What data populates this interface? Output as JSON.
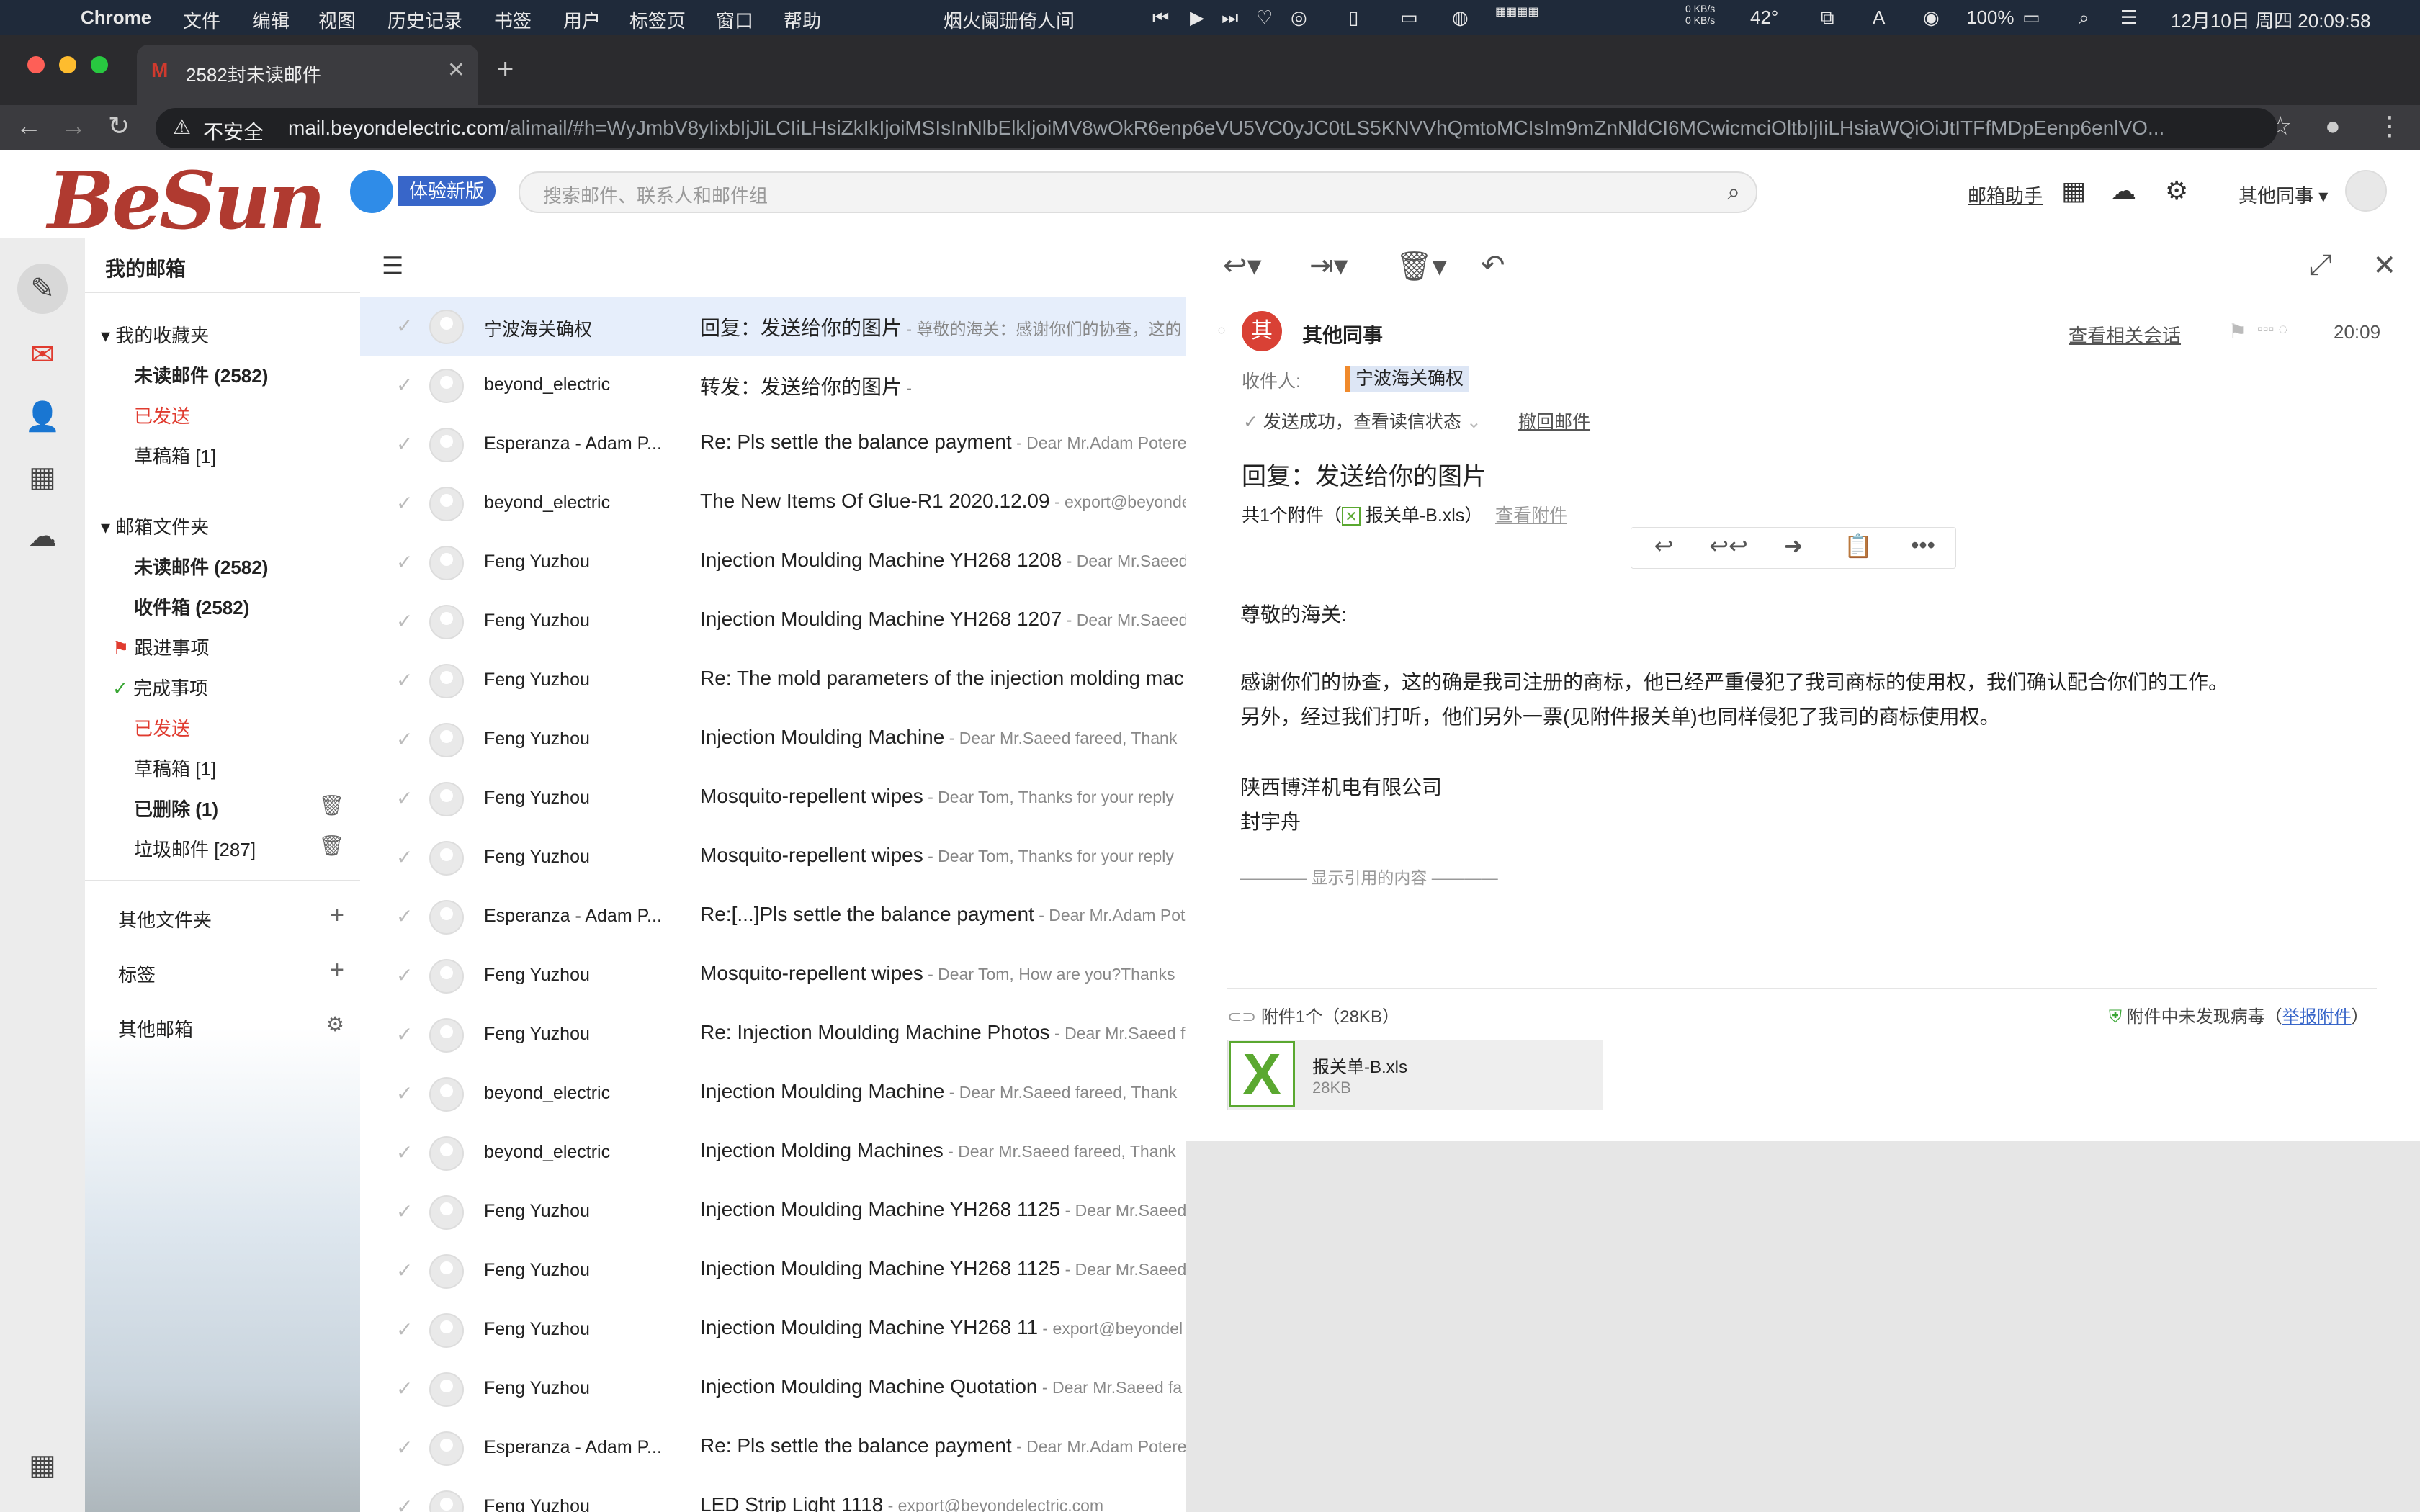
{
  "menubar": {
    "app": "Chrome",
    "items": [
      "文件",
      "编辑",
      "视图",
      "历史记录",
      "书签",
      "用户",
      "标签页",
      "窗口",
      "帮助"
    ],
    "now_playing": "烟火阑珊倚人间",
    "net_up": "0 KB/s",
    "net_down": "0 KB/s",
    "temp": "42°",
    "battery": "100%",
    "datetime": "12月10日 周四 20:09:58"
  },
  "browser": {
    "tab_title": "2582封未读邮件",
    "insecure_label": "不安全",
    "url_host": "mail.beyondelectric.com",
    "url_rest": "/alimail/#h=WyJmbV8yIixbIjJiLCIiLHsiZkIkIjoiMSIsInNlbElkIjoiMV8wOkR6enp6eVU5VC0yJC0tLS5KNVVhQmtoMCIsIm9mZnNldCI6MCwicmciOltbIjIiLHsiaWQiOiJtITFfMDpEenp6enlVO..."
  },
  "header": {
    "logo_text": "BeSun",
    "try_new": "体验新版",
    "search_placeholder": "搜索邮件、联系人和邮件组",
    "assistant": "邮箱助手",
    "account": "其他同事"
  },
  "folders": {
    "title": "我的邮箱",
    "fav_section": "我的收藏夹",
    "fav_unread": "未读邮件 (2582)",
    "fav_sent": "已发送",
    "fav_drafts": "草稿箱 [1]",
    "mail_section": "邮箱文件夹",
    "unread": "未读邮件 (2582)",
    "inbox": "收件箱 (2582)",
    "followup": "跟进事项",
    "done": "完成事项",
    "sent": "已发送",
    "drafts": "草稿箱 [1]",
    "deleted": "已删除 (1)",
    "spam": "垃圾邮件 [287]",
    "other_folders": "其他文件夹",
    "tags": "标签",
    "other_mailboxes": "其他邮箱"
  },
  "messages": [
    {
      "from": "宁波海关确权",
      "subject": "回复：发送给你的图片",
      "preview": " - 尊敬的海关：感谢你们的协查，这的",
      "selected": true
    },
    {
      "from": "beyond_electric",
      "subject": "转发：发送给你的图片",
      "preview": " -"
    },
    {
      "from": "Esperanza - Adam P...",
      "subject": "Re: Pls settle the balance payment",
      "preview": " - Dear Mr.Adam Potere"
    },
    {
      "from": "beyond_electric",
      "subject": "The New Items Of Glue-R1 2020.12.09",
      "preview": " - export@beyonde"
    },
    {
      "from": "Feng Yuzhou",
      "subject": "Injection Moulding Machine YH268 1208",
      "preview": " - Dear Mr.Saeed"
    },
    {
      "from": "Feng Yuzhou",
      "subject": "Injection Moulding Machine YH268 1207",
      "preview": " - Dear Mr.Saeed"
    },
    {
      "from": "Feng Yuzhou",
      "subject": "Re: The mold parameters of the injection molding mac",
      "preview": ""
    },
    {
      "from": "Feng Yuzhou",
      "subject": "Injection Moulding Machine",
      "preview": " - Dear Mr.Saeed fareed, Thank"
    },
    {
      "from": "Feng Yuzhou",
      "subject": "Mosquito-repellent wipes",
      "preview": " - Dear Tom, Thanks for your reply"
    },
    {
      "from": "Feng Yuzhou",
      "subject": "Mosquito-repellent wipes",
      "preview": " - Dear Tom, Thanks for your reply"
    },
    {
      "from": "Esperanza - Adam P...",
      "subject": "Re:[...]Pls settle the balance payment",
      "preview": " - Dear Mr.Adam Pot"
    },
    {
      "from": "Feng Yuzhou",
      "subject": "Mosquito-repellent wipes",
      "preview": " - Dear Tom, How are you?Thanks"
    },
    {
      "from": "Feng Yuzhou",
      "subject": "Re: Injection Moulding Machine Photos",
      "preview": " - Dear Mr.Saeed f"
    },
    {
      "from": "beyond_electric",
      "subject": "Injection Moulding Machine",
      "preview": " - Dear Mr.Saeed fareed, Thank"
    },
    {
      "from": "beyond_electric",
      "subject": "Injection Molding Machines",
      "preview": " - Dear Mr.Saeed fareed, Thank"
    },
    {
      "from": "Feng Yuzhou",
      "subject": "Injection Moulding Machine YH268 1125",
      "preview": " - Dear Mr.Saeed"
    },
    {
      "from": "Feng Yuzhou",
      "subject": "Injection Moulding Machine YH268 1125",
      "preview": " - Dear Mr.Saeed"
    },
    {
      "from": "Feng Yuzhou",
      "subject": "Injection Moulding Machine YH268 11",
      "preview": " - export@beyondel"
    },
    {
      "from": "Feng Yuzhou",
      "subject": "Injection Moulding Machine Quotation",
      "preview": " - Dear Mr.Saeed fa"
    },
    {
      "from": "Esperanza - Adam P...",
      "subject": "Re: Pls settle the balance payment",
      "preview": " - Dear Mr.Adam Potere"
    },
    {
      "from": "Feng Yuzhou",
      "subject": "LED Strip Light 1118",
      "preview": " - export@beyondelectric.com"
    }
  ],
  "reader": {
    "sender_initial": "其",
    "sender": "其他同事",
    "related": "查看相关会话",
    "time": "20:09",
    "to_label": "收件人:",
    "to": "宁波海关确权",
    "status": "发送成功，查看读信状态",
    "recall": "撤回邮件",
    "subject": "回复：发送给你的图片",
    "att_summary": "共1个附件（",
    "att_name_inline": "报关单-B.xls）",
    "view_att": "查看附件",
    "body": [
      "尊敬的海关:",
      "感谢你们的协查，这的确是我司注册的商标，他已经严重侵犯了我司商标的使用权，我们确认配合你们的工作。",
      "另外，经过我们打听，他们另外一票(见附件报关单)也同样侵犯了我司的商标使用权。",
      "陕西博洋机电有限公司",
      "封宇舟"
    ],
    "show_quoted": "显示引用的内容",
    "att_header": "附件1个（28KB）",
    "virus_ok": "附件中未发现病毒（",
    "report_att": "举报附件",
    "virus_close": "）",
    "att_file": "报关单-B.xls",
    "att_size": "28KB"
  },
  "colors": {
    "accent": "#3866c9",
    "brand_red": "#b03a30",
    "unread_red": "#e03b2f",
    "excel_green": "#5aa830"
  }
}
